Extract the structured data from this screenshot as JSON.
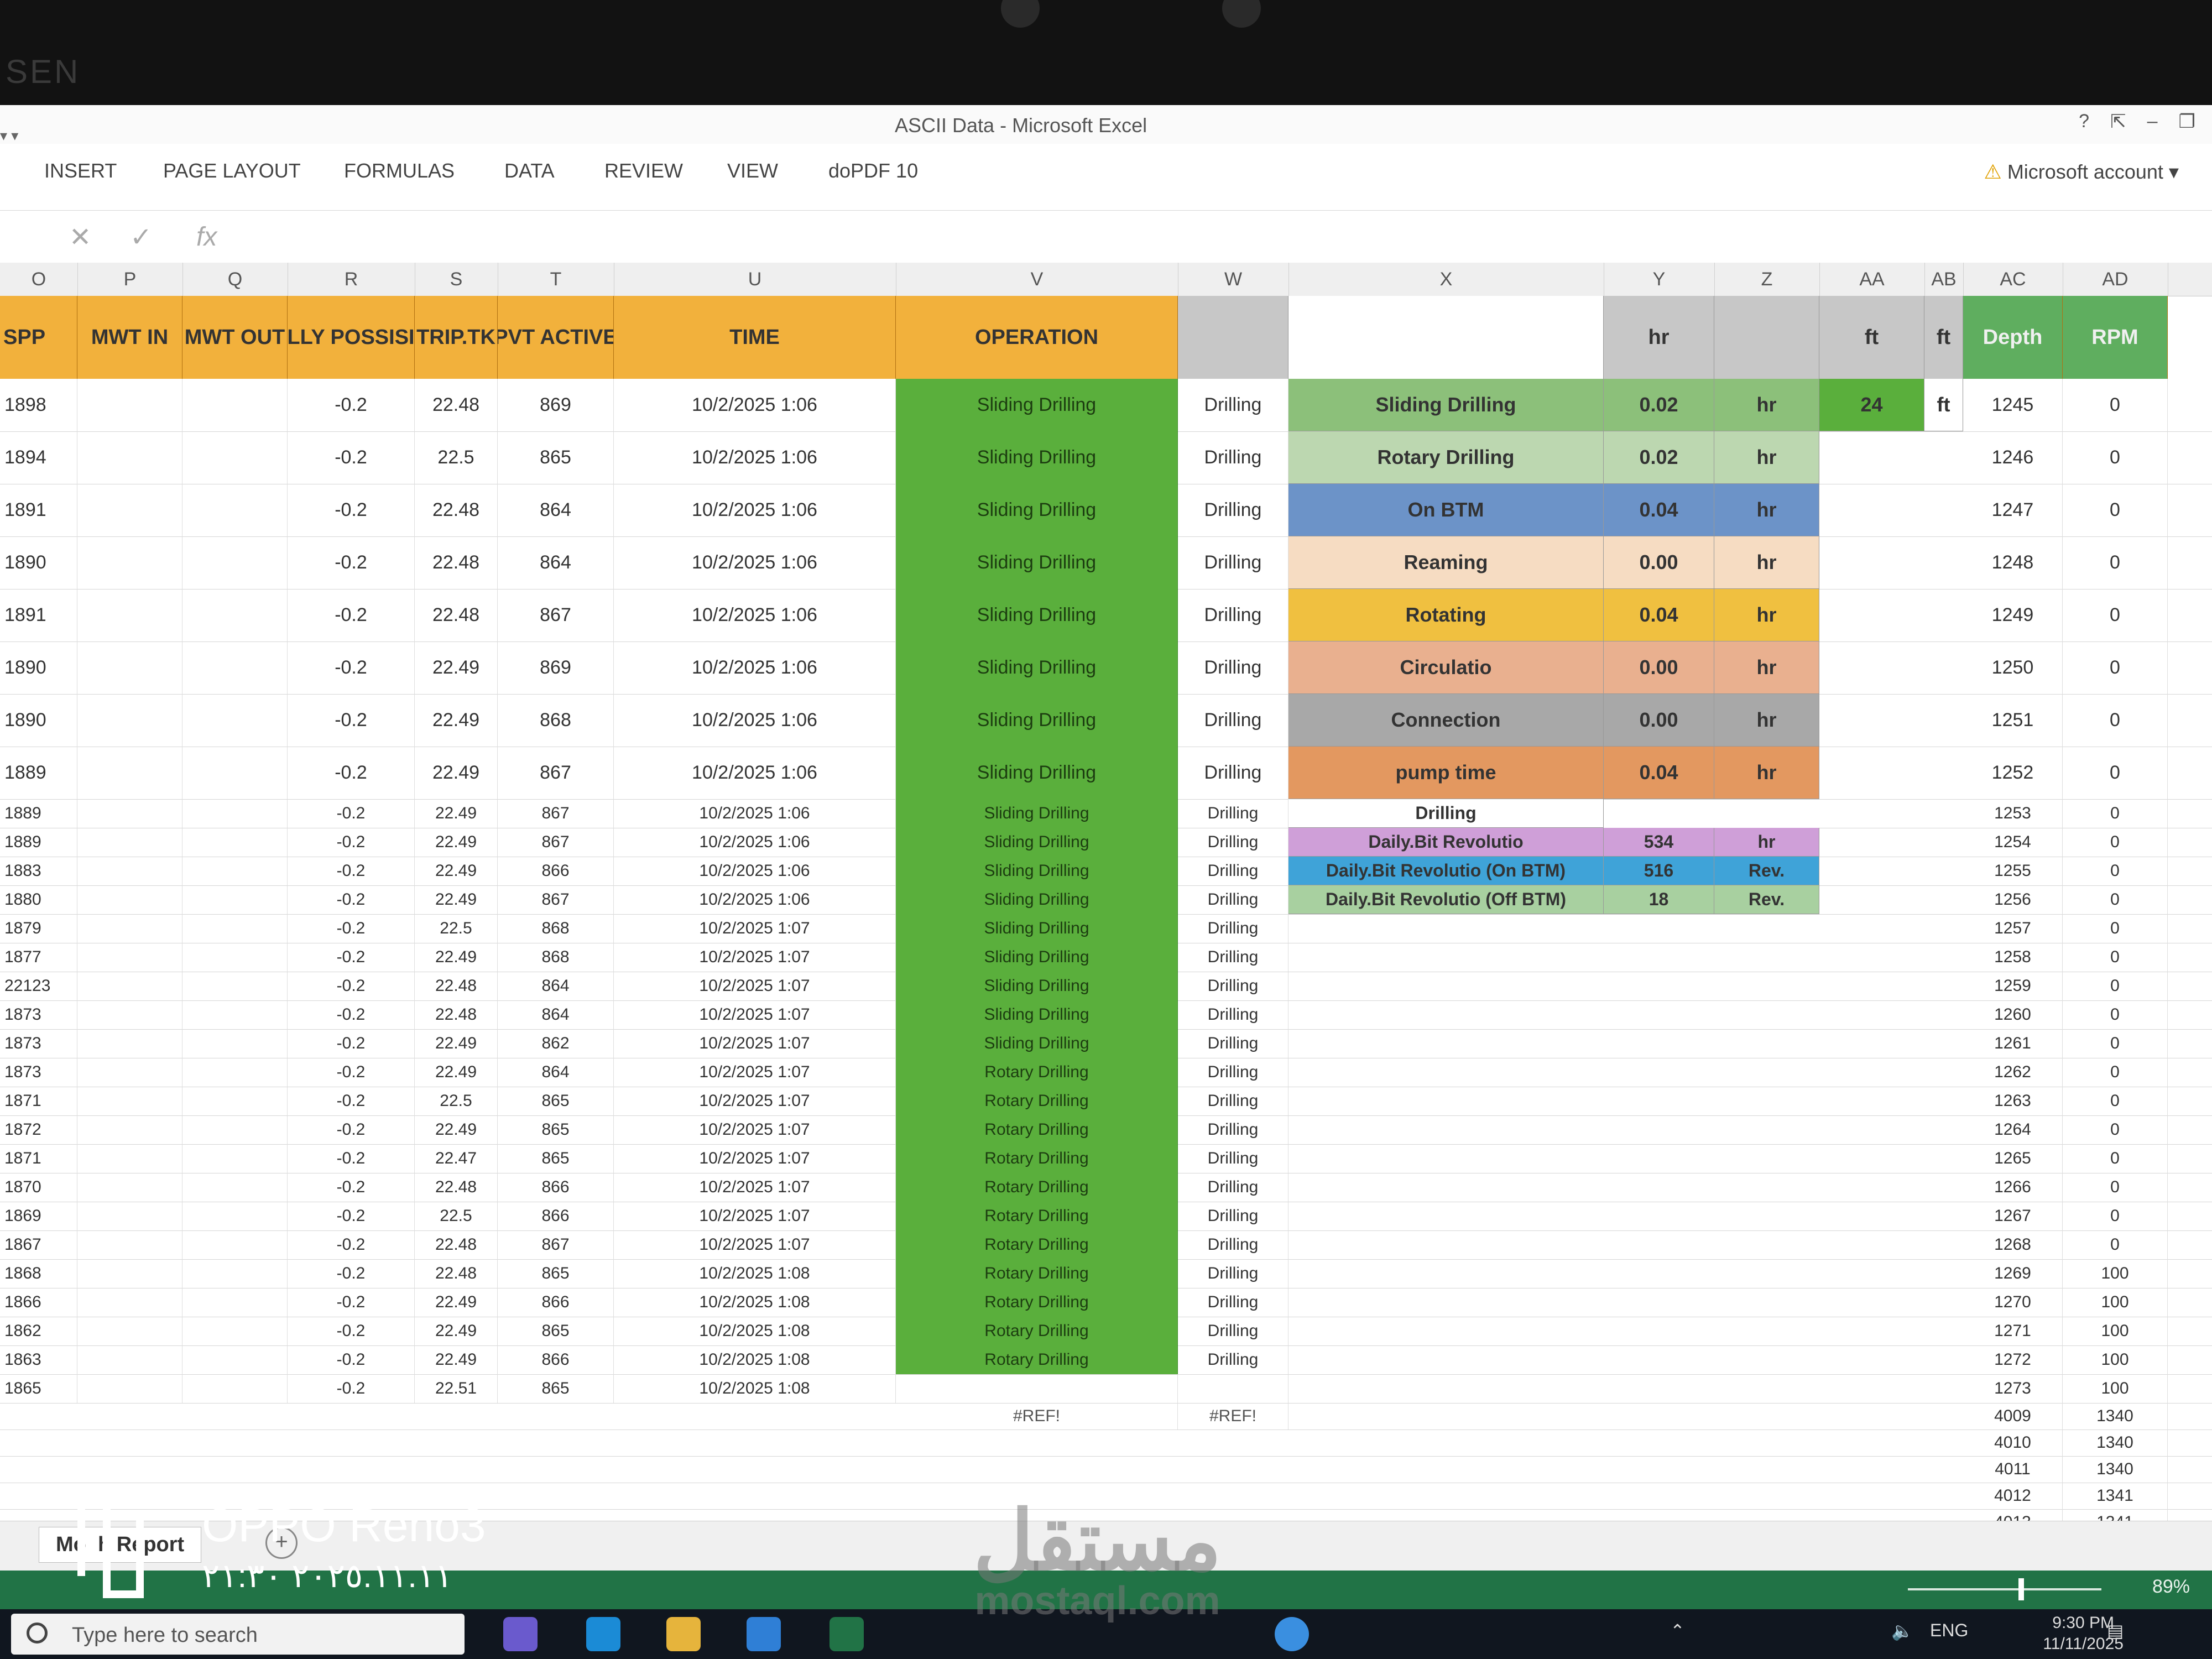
{
  "app": {
    "title": "ASCII Data - Microsoft Excel",
    "bezel_brand": "SEN",
    "help": "?",
    "qat": "▾ ▾"
  },
  "ribbon": {
    "tabs": [
      "INSERT",
      "PAGE LAYOUT",
      "FORMULAS",
      "DATA",
      "REVIEW",
      "VIEW",
      "doPDF 10"
    ],
    "account": "Microsoft account ▾",
    "account_warning": "⚠"
  },
  "formula_bar": {
    "cancel": "✕",
    "confirm": "✓",
    "fx": "fx"
  },
  "columns": [
    "O",
    "P",
    "Q",
    "R",
    "S",
    "T",
    "U",
    "V",
    "W",
    "X",
    "Y",
    "Z",
    "AA",
    "AB",
    "AC",
    "AD"
  ],
  "headers": {
    "O": "SPP",
    "P": "MWT IN",
    "Q": "MWT OUT",
    "R": "LLY POSSISI",
    "S": "TRIP.TK",
    "T": "PVT ACTIVE",
    "U": "TIME",
    "V": "OPERATION",
    "W": "",
    "X": "",
    "Y": "hr",
    "Z": "",
    "AA": "ft",
    "AB": "ft",
    "AC": "Depth",
    "AD": "RPM"
  },
  "rows": [
    {
      "spp": "1898",
      "r": "-0.2",
      "s": "22.48",
      "t": "869",
      "time": "10/2/2025 1:06",
      "op": "Sliding Drilling",
      "w": "Drilling",
      "depth": "1245",
      "rpm": "0"
    },
    {
      "spp": "1894",
      "r": "-0.2",
      "s": "22.5",
      "t": "865",
      "time": "10/2/2025 1:06",
      "op": "Sliding Drilling",
      "w": "Drilling",
      "depth": "1246",
      "rpm": "0"
    },
    {
      "spp": "1891",
      "r": "-0.2",
      "s": "22.48",
      "t": "864",
      "time": "10/2/2025 1:06",
      "op": "Sliding Drilling",
      "w": "Drilling",
      "depth": "1247",
      "rpm": "0"
    },
    {
      "spp": "1890",
      "r": "-0.2",
      "s": "22.48",
      "t": "864",
      "time": "10/2/2025 1:06",
      "op": "Sliding Drilling",
      "w": "Drilling",
      "depth": "1248",
      "rpm": "0"
    },
    {
      "spp": "1891",
      "r": "-0.2",
      "s": "22.48",
      "t": "867",
      "time": "10/2/2025 1:06",
      "op": "Sliding Drilling",
      "w": "Drilling",
      "depth": "1249",
      "rpm": "0"
    },
    {
      "spp": "1890",
      "r": "-0.2",
      "s": "22.49",
      "t": "869",
      "time": "10/2/2025 1:06",
      "op": "Sliding Drilling",
      "w": "Drilling",
      "depth": "1250",
      "rpm": "0"
    },
    {
      "spp": "1890",
      "r": "-0.2",
      "s": "22.49",
      "t": "868",
      "time": "10/2/2025 1:06",
      "op": "Sliding Drilling",
      "w": "Drilling",
      "depth": "1251",
      "rpm": "0"
    },
    {
      "spp": "1889",
      "r": "-0.2",
      "s": "22.49",
      "t": "867",
      "time": "10/2/2025 1:06",
      "op": "Sliding Drilling",
      "w": "Drilling",
      "depth": "1252",
      "rpm": "0"
    },
    {
      "spp": "1889",
      "r": "-0.2",
      "s": "22.49",
      "t": "867",
      "time": "10/2/2025 1:06",
      "op": "Sliding Drilling",
      "w": "Drilling",
      "depth": "1253",
      "rpm": "0"
    },
    {
      "spp": "1889",
      "r": "-0.2",
      "s": "22.49",
      "t": "867",
      "time": "10/2/2025 1:06",
      "op": "Sliding Drilling",
      "w": "Drilling",
      "depth": "1254",
      "rpm": "0"
    },
    {
      "spp": "1883",
      "r": "-0.2",
      "s": "22.49",
      "t": "866",
      "time": "10/2/2025 1:06",
      "op": "Sliding Drilling",
      "w": "Drilling",
      "depth": "1255",
      "rpm": "0"
    },
    {
      "spp": "1880",
      "r": "-0.2",
      "s": "22.49",
      "t": "867",
      "time": "10/2/2025 1:06",
      "op": "Sliding Drilling",
      "w": "Drilling",
      "depth": "1256",
      "rpm": "0"
    },
    {
      "spp": "1879",
      "r": "-0.2",
      "s": "22.5",
      "t": "868",
      "time": "10/2/2025 1:07",
      "op": "Sliding Drilling",
      "w": "Drilling",
      "depth": "1257",
      "rpm": "0"
    },
    {
      "spp": "1877",
      "r": "-0.2",
      "s": "22.49",
      "t": "868",
      "time": "10/2/2025 1:07",
      "op": "Sliding Drilling",
      "w": "Drilling",
      "depth": "1258",
      "rpm": "0"
    },
    {
      "spp": "22123",
      "r": "-0.2",
      "s": "22.48",
      "t": "864",
      "time": "10/2/2025 1:07",
      "op": "Sliding Drilling",
      "w": "Drilling",
      "depth": "1259",
      "rpm": "0"
    },
    {
      "spp": "1873",
      "r": "-0.2",
      "s": "22.48",
      "t": "864",
      "time": "10/2/2025 1:07",
      "op": "Sliding Drilling",
      "w": "Drilling",
      "depth": "1260",
      "rpm": "0"
    },
    {
      "spp": "1873",
      "r": "-0.2",
      "s": "22.49",
      "t": "862",
      "time": "10/2/2025 1:07",
      "op": "Sliding Drilling",
      "w": "Drilling",
      "depth": "1261",
      "rpm": "0"
    },
    {
      "spp": "1873",
      "r": "-0.2",
      "s": "22.49",
      "t": "864",
      "time": "10/2/2025 1:07",
      "op": "Rotary Drilling",
      "w": "Drilling",
      "depth": "1262",
      "rpm": "0"
    },
    {
      "spp": "1871",
      "r": "-0.2",
      "s": "22.5",
      "t": "865",
      "time": "10/2/2025 1:07",
      "op": "Rotary Drilling",
      "w": "Drilling",
      "depth": "1263",
      "rpm": "0"
    },
    {
      "spp": "1872",
      "r": "-0.2",
      "s": "22.49",
      "t": "865",
      "time": "10/2/2025 1:07",
      "op": "Rotary Drilling",
      "w": "Drilling",
      "depth": "1264",
      "rpm": "0"
    },
    {
      "spp": "1871",
      "r": "-0.2",
      "s": "22.47",
      "t": "865",
      "time": "10/2/2025 1:07",
      "op": "Rotary Drilling",
      "w": "Drilling",
      "depth": "1265",
      "rpm": "0"
    },
    {
      "spp": "1870",
      "r": "-0.2",
      "s": "22.48",
      "t": "866",
      "time": "10/2/2025 1:07",
      "op": "Rotary Drilling",
      "w": "Drilling",
      "depth": "1266",
      "rpm": "0"
    },
    {
      "spp": "1869",
      "r": "-0.2",
      "s": "22.5",
      "t": "866",
      "time": "10/2/2025 1:07",
      "op": "Rotary Drilling",
      "w": "Drilling",
      "depth": "1267",
      "rpm": "0"
    },
    {
      "spp": "1867",
      "r": "-0.2",
      "s": "22.48",
      "t": "867",
      "time": "10/2/2025 1:07",
      "op": "Rotary Drilling",
      "w": "Drilling",
      "depth": "1268",
      "rpm": "0"
    },
    {
      "spp": "1868",
      "r": "-0.2",
      "s": "22.48",
      "t": "865",
      "time": "10/2/2025 1:08",
      "op": "Rotary Drilling",
      "w": "Drilling",
      "depth": "1269",
      "rpm": "100"
    },
    {
      "spp": "1866",
      "r": "-0.2",
      "s": "22.49",
      "t": "866",
      "time": "10/2/2025 1:08",
      "op": "Rotary Drilling",
      "w": "Drilling",
      "depth": "1270",
      "rpm": "100"
    },
    {
      "spp": "1862",
      "r": "-0.2",
      "s": "22.49",
      "t": "865",
      "time": "10/2/2025 1:08",
      "op": "Rotary Drilling",
      "w": "Drilling",
      "depth": "1271",
      "rpm": "100"
    },
    {
      "spp": "1863",
      "r": "-0.2",
      "s": "22.49",
      "t": "866",
      "time": "10/2/2025 1:08",
      "op": "Rotary Drilling",
      "w": "Drilling",
      "depth": "1272",
      "rpm": "100"
    },
    {
      "spp": "1865",
      "r": "-0.2",
      "s": "22.51",
      "t": "865",
      "time": "10/2/2025 1:08",
      "op": "",
      "w": "",
      "depth": "1273",
      "rpm": "100"
    }
  ],
  "ref_row": {
    "op": "#REF!",
    "w": "#REF!"
  },
  "extra_depth": [
    {
      "depth": "4009",
      "rpm": "1340"
    },
    {
      "depth": "4010",
      "rpm": "1340"
    },
    {
      "depth": "4011",
      "rpm": "1340"
    },
    {
      "depth": "4012",
      "rpm": "1341"
    },
    {
      "depth": "4013",
      "rpm": "1341"
    }
  ],
  "summary": [
    {
      "label": "Sliding Drilling",
      "value": "0.02",
      "unit": "hr",
      "color": "#8cc07a"
    },
    {
      "label": "Rotary Drilling",
      "value": "0.02",
      "unit": "hr",
      "color": "#bcd7b0"
    },
    {
      "label": "On BTM",
      "value": "0.04",
      "unit": "hr",
      "color": "#6c93c8"
    },
    {
      "label": "Reaming",
      "value": "0.00",
      "unit": "hr",
      "color": "#f6dcc2"
    },
    {
      "label": "Rotating",
      "value": "0.04",
      "unit": "hr",
      "color": "#f0c040"
    },
    {
      "label": "Circulatio",
      "value": "0.00",
      "unit": "hr",
      "color": "#e9b08f"
    },
    {
      "label": "Connection",
      "value": "0.00",
      "unit": "hr",
      "color": "#a8a8a8"
    },
    {
      "label": "pump time",
      "value": "0.04",
      "unit": "hr",
      "color": "#e39860"
    }
  ],
  "summary_extra": {
    "aa_first": "24",
    "ab_first": "ft",
    "drilling_label": "Drilling",
    "bitrev": [
      {
        "label": "Daily.Bit Revolutio",
        "value": "534",
        "unit": "hr",
        "color": "#cf9fd8"
      },
      {
        "label": "Daily.Bit Revolutio (On BTM)",
        "value": "516",
        "unit": "Rev.",
        "color": "#3fa3d8"
      },
      {
        "label": "Daily.Bit Revolutio (Off BTM)",
        "value": "18",
        "unit": "Rev.",
        "color": "#a8d0a0"
      }
    ]
  },
  "sheet": {
    "tab": "Mo  h Report",
    "add": "+"
  },
  "status": {
    "zoom": "89%"
  },
  "taskbar": {
    "search": "Type here to search",
    "lang": "ENG",
    "time": "9:30 PM",
    "date": "11/11/2025"
  },
  "overlay": {
    "model": "OPPO Reno3",
    "stamp": "٢٠٢٥.١١.١١  ٢١:٣٠",
    "watermark_ar": "مستقل",
    "watermark_url": "mostaql.com"
  }
}
